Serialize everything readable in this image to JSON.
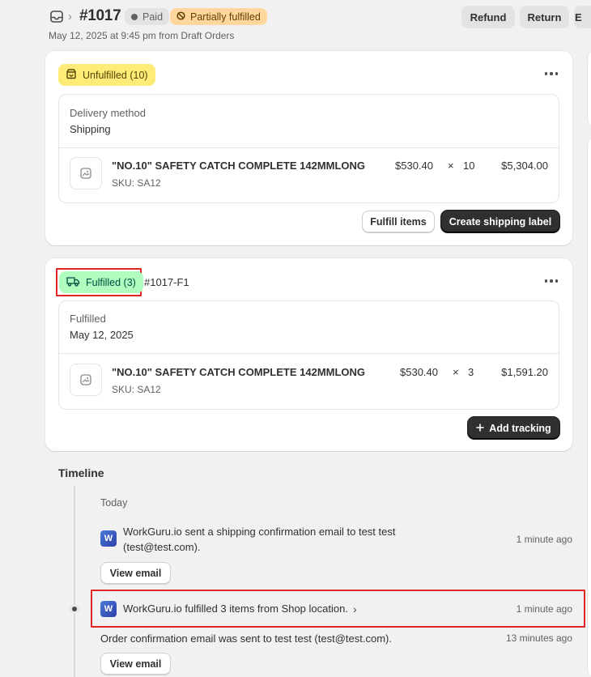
{
  "header": {
    "order_number": "#1017",
    "separator": "›",
    "paid_badge": "Paid",
    "fulfillment_badge": "Partially fulfilled",
    "subtitle": "May 12, 2025 at 9:45 pm from Draft Orders",
    "buttons": {
      "refund": "Refund",
      "return": "Return",
      "edit": "E"
    }
  },
  "unfulfilled_card": {
    "status": "Unfulfilled (10)",
    "delivery_method_label": "Delivery method",
    "delivery_method_value": "Shipping",
    "item": {
      "name": "\"NO.10\" SAFETY CATCH COMPLETE 142MMLONG",
      "sku": "SKU: SA12",
      "price": "$530.40",
      "times": "×",
      "quantity": "10",
      "total": "$5,304.00"
    },
    "fulfill_button": "Fulfill items",
    "label_button": "Create shipping label"
  },
  "fulfilled_card": {
    "status": "Fulfilled (3)",
    "fulfillment_id": "#1017-F1",
    "section_label": "Fulfilled",
    "section_value": "May 12, 2025",
    "item": {
      "name": "\"NO.10\" SAFETY CATCH COMPLETE 142MMLONG",
      "sku": "SKU: SA12",
      "price": "$530.40",
      "times": "×",
      "quantity": "3",
      "total": "$1,591.20"
    },
    "tracking_button": "Add tracking"
  },
  "timeline": {
    "title": "Timeline",
    "day": "Today",
    "events": [
      {
        "text": "WorkGuru.io sent a shipping confirmation email to test test (test@test.com).",
        "time": "1 minute ago",
        "button": "View email",
        "avatar": "W"
      },
      {
        "text": "WorkGuru.io fulfilled 3 items from Shop location.",
        "chevron": "›",
        "time": "1 minute ago",
        "avatar": "W"
      },
      {
        "text": "Order confirmation email was sent to test test (test@test.com).",
        "time": "13 minutes ago",
        "button": "View email"
      }
    ]
  },
  "colors": {
    "unfulfilled_badge": "#ffeb78",
    "fulfilled_badge": "#affebf",
    "partial_badge": "#ffd79d",
    "highlight": "#e02424",
    "primary_button": "#303030"
  },
  "icons": [
    "order-icon",
    "dot-icon",
    "partial-fulfilled-icon",
    "unfulfilled-box-icon",
    "delivery-truck-icon",
    "more-actions-icon",
    "image-placeholder-icon",
    "plus-icon",
    "chevron-right-icon",
    "workguru-logo-icon"
  ]
}
